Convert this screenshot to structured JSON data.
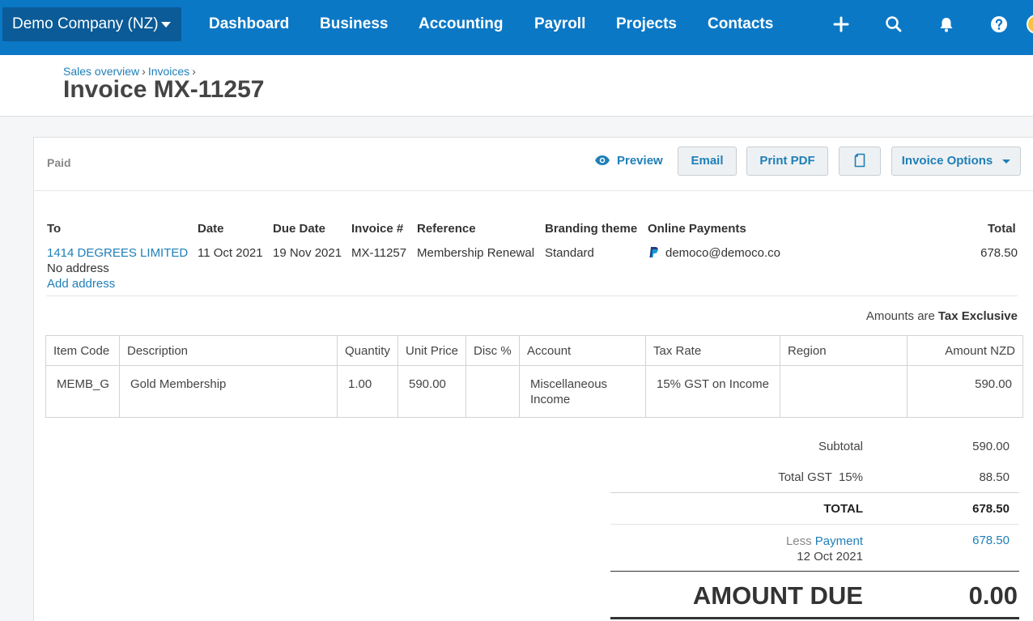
{
  "nav": {
    "org": "Demo Company (NZ)",
    "items": [
      "Dashboard",
      "Business",
      "Accounting",
      "Payroll",
      "Projects",
      "Contacts"
    ]
  },
  "header": {
    "breadcrumb": [
      "Sales overview",
      "Invoices"
    ],
    "title": "Invoice MX-11257"
  },
  "toolbar": {
    "status": "Paid",
    "preview": "Preview",
    "email": "Email",
    "print_pdf": "Print PDF",
    "options": "Invoice Options"
  },
  "details": {
    "labels": {
      "to": "To",
      "date": "Date",
      "due_date": "Due Date",
      "invoice_no": "Invoice #",
      "reference": "Reference",
      "branding": "Branding theme",
      "online_payments": "Online Payments",
      "total": "Total"
    },
    "to": "1414 DEGREES LIMITED",
    "no_address": "No address",
    "add_address": "Add address",
    "date": "11 Oct 2021",
    "due_date": "19 Nov 2021",
    "invoice_no": "MX-11257",
    "reference": "Membership Renewal",
    "branding": "Standard",
    "online_payments": "democo@democo.co",
    "total": "678.50"
  },
  "amounts_note": {
    "label": "Amounts are",
    "value": "Tax Exclusive"
  },
  "lines": {
    "headers": [
      "Item Code",
      "Description",
      "Quantity",
      "Unit Price",
      "Disc %",
      "Account",
      "Tax Rate",
      "Region",
      "Amount NZD"
    ],
    "rows": [
      {
        "item_code": "MEMB_G",
        "description": "Gold Membership",
        "quantity": "1.00",
        "unit_price": "590.00",
        "disc": "",
        "account": "Miscellaneous Income",
        "tax_rate": "15% GST on Income",
        "region": "",
        "amount": "590.00"
      }
    ]
  },
  "totals": {
    "subtotal_label": "Subtotal",
    "subtotal": "590.00",
    "gst_label": "Total GST  15%",
    "gst": "88.50",
    "total_label": "TOTAL",
    "total": "678.50",
    "less_label": "Less",
    "payment_label": "Payment",
    "payment_date": "12 Oct 2021",
    "payment": "678.50",
    "due_label": "AMOUNT DUE",
    "due": "0.00"
  },
  "colors": {
    "nav_bg": "#0b78c6",
    "org_bg": "#0a5b97",
    "link": "#1e7fb8"
  }
}
